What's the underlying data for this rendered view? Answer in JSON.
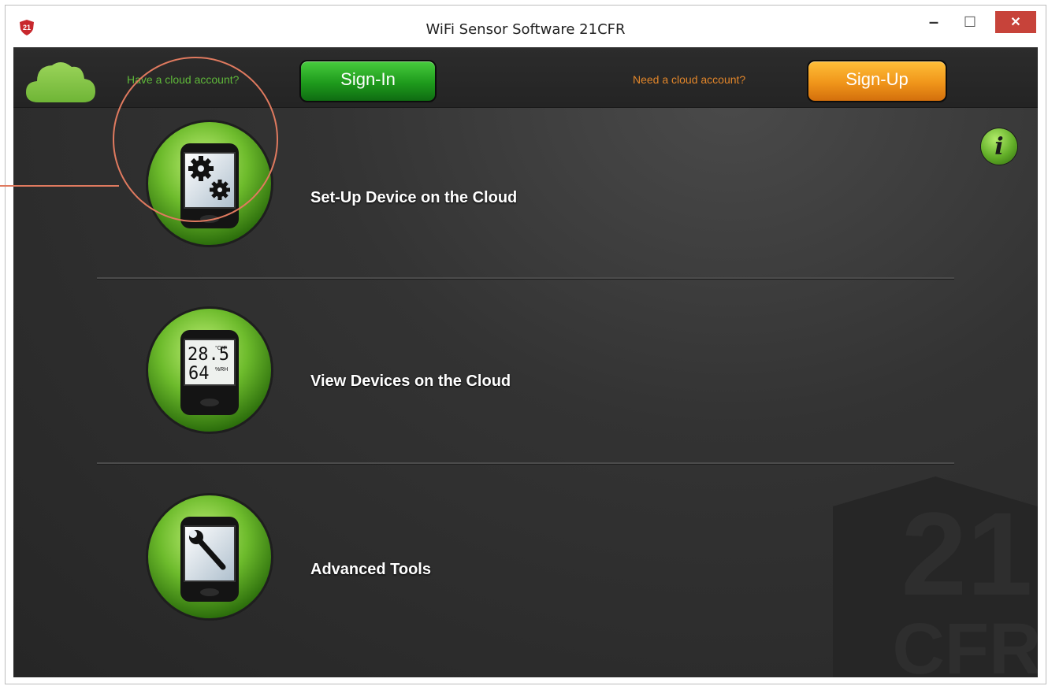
{
  "window": {
    "title": "WiFi Sensor Software 21CFR",
    "app_logo_text": "21",
    "minimize_glyph": "–",
    "maximize_glyph": "☐",
    "close_glyph": "✕"
  },
  "topbar": {
    "have_account_text": "Have a cloud account?",
    "signin_label": "Sign-In",
    "need_account_text": "Need a cloud account?",
    "signup_label": "Sign-Up",
    "cloud_icon": "cloud-icon"
  },
  "info_button": {
    "glyph": "i",
    "icon": "info-icon"
  },
  "menu": {
    "items": [
      {
        "label": "Set-Up Device on the Cloud",
        "icon": "gears-device-icon"
      },
      {
        "label": "View Devices on the Cloud",
        "icon": "display-device-icon",
        "lcd_line1": "28.5",
        "lcd_unit1": "°C°F",
        "lcd_line2": "64",
        "lcd_unit2": "%RH"
      },
      {
        "label": "Advanced Tools",
        "icon": "wrench-device-icon"
      }
    ]
  },
  "watermark": {
    "top_text": "21",
    "bottom_text": "CFR"
  },
  "colors": {
    "signin_green": "#1e9a1c",
    "signup_orange": "#f0951a",
    "have_account_green": "#5fb83a",
    "need_account_orange": "#e2862a",
    "highlight": "#e07a5f",
    "close_red": "#c7433a"
  }
}
